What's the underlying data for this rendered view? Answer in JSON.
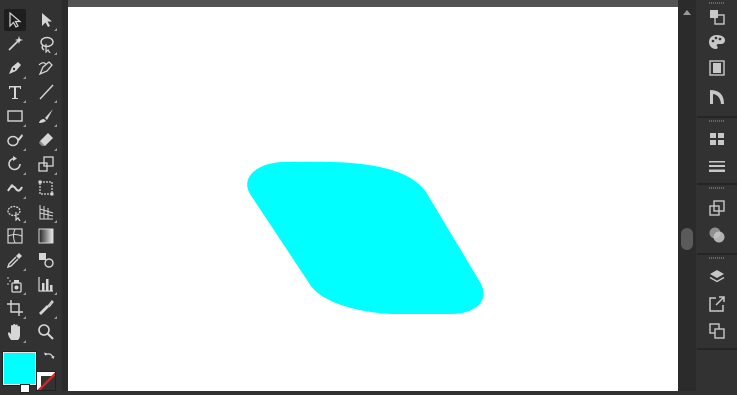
{
  "colors": {
    "fill": "#00ffff",
    "stroke": "none",
    "panel": "#323232",
    "artboard": "#ffffff",
    "icon": "#c8c8c8"
  },
  "toolbar": {
    "tools": [
      "selection-tool",
      "direct-selection-tool",
      "magic-wand-tool",
      "lasso-tool",
      "pen-tool",
      "curvature-tool",
      "type-tool",
      "line-segment-tool",
      "rectangle-tool",
      "paintbrush-tool",
      "shaper-tool",
      "eraser-tool",
      "rotate-tool",
      "scale-tool",
      "puppet-warp-tool",
      "free-transform-tool",
      "shape-builder-tool",
      "perspective-grid-tool",
      "mesh-tool",
      "gradient-tool",
      "eyedropper-tool",
      "blend-tool",
      "symbol-sprayer-tool",
      "column-graph-tool",
      "artboard-tool",
      "slice-tool",
      "hand-tool",
      "zoom-tool"
    ],
    "selected_tool": "selection-tool"
  },
  "right_dock": {
    "panels": [
      "transform-panel",
      "color-panel",
      "libraries-panel",
      "gradient-panel",
      "align-panel",
      "stroke-panel",
      "pathfinder-panel",
      "transparency-panel",
      "layers-panel",
      "export-panel",
      "artboards-panel"
    ]
  }
}
